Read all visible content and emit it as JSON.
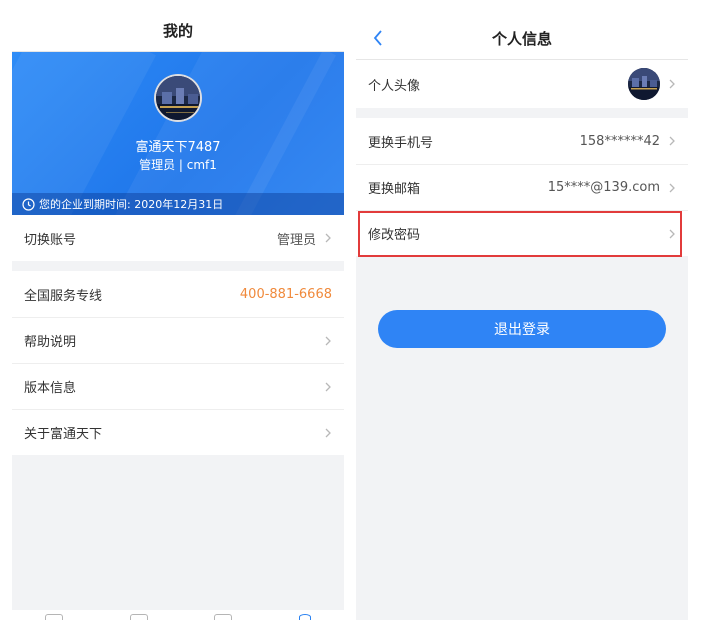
{
  "left": {
    "title": "我的",
    "profile": {
      "name": "富通天下7487",
      "role": "管理员 | cmf1",
      "expiry": "您的企业到期时间: 2020年12月31日"
    },
    "switch_account": {
      "label": "切换账号",
      "value": "管理员"
    },
    "menu": [
      {
        "label": "全国服务专线",
        "value": "400-881-6668"
      },
      {
        "label": "帮助说明"
      },
      {
        "label": "版本信息"
      },
      {
        "label": "关于富通天下"
      }
    ]
  },
  "right": {
    "title": "个人信息",
    "avatar_label": "个人头像",
    "phone": {
      "label": "更换手机号",
      "value": "158******42"
    },
    "email": {
      "label": "更换邮箱",
      "value": "15****@139.com"
    },
    "password": {
      "label": "修改密码"
    },
    "logout_label": "退出登录"
  },
  "colors": {
    "accent": "#2f84f5",
    "orange": "#f08a3c",
    "highlight": "#e23b3b"
  },
  "icons": [
    "back-chevron-icon",
    "clock-icon",
    "chevron-right-icon",
    "avatar-photo"
  ]
}
